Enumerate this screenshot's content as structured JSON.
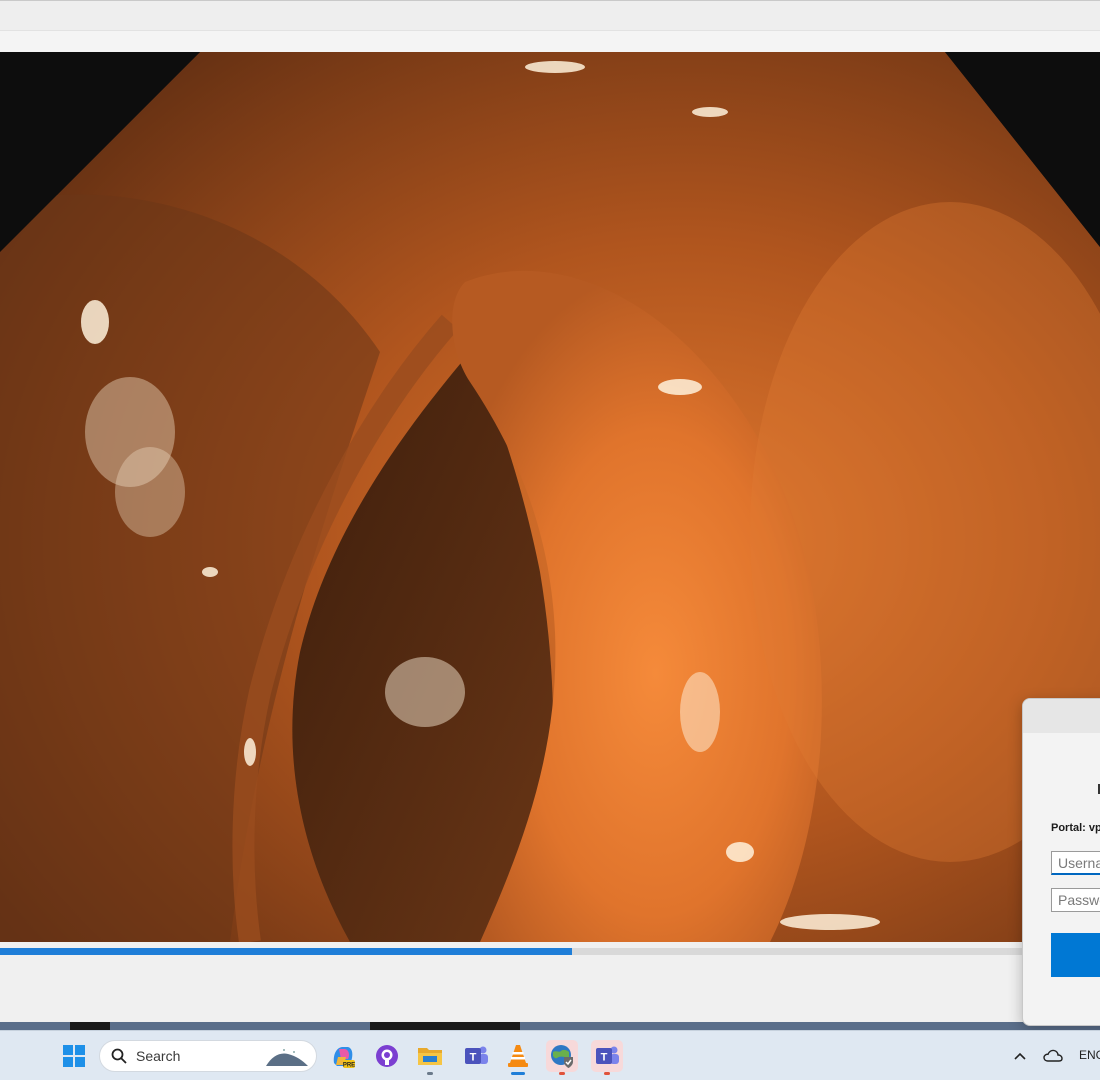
{
  "taskbar": {
    "search_label": "Search",
    "language": "ENG",
    "apps": [
      {
        "name": "Copilot",
        "icon": "copilot-icon"
      },
      {
        "name": "GitHub Desktop",
        "icon": "github-icon"
      },
      {
        "name": "File Explorer",
        "icon": "folder-icon"
      },
      {
        "name": "Microsoft Teams",
        "icon": "teams-icon"
      },
      {
        "name": "VLC media player",
        "icon": "vlc-icon"
      },
      {
        "name": "VPN client",
        "icon": "globe-shield-icon"
      },
      {
        "name": "Microsoft Teams (work)",
        "icon": "teams-icon"
      }
    ]
  },
  "player": {
    "progress": 0.52
  },
  "vpn_dialog": {
    "portal_label": "Portal: vp",
    "username_placeholder": "Userna",
    "password_placeholder": "Passwo"
  },
  "colors": {
    "accent": "#1f7ed8",
    "dialog_button": "#0078d4",
    "tissue_bright": "#f08a3c",
    "tissue_dark": "#6a3414"
  }
}
